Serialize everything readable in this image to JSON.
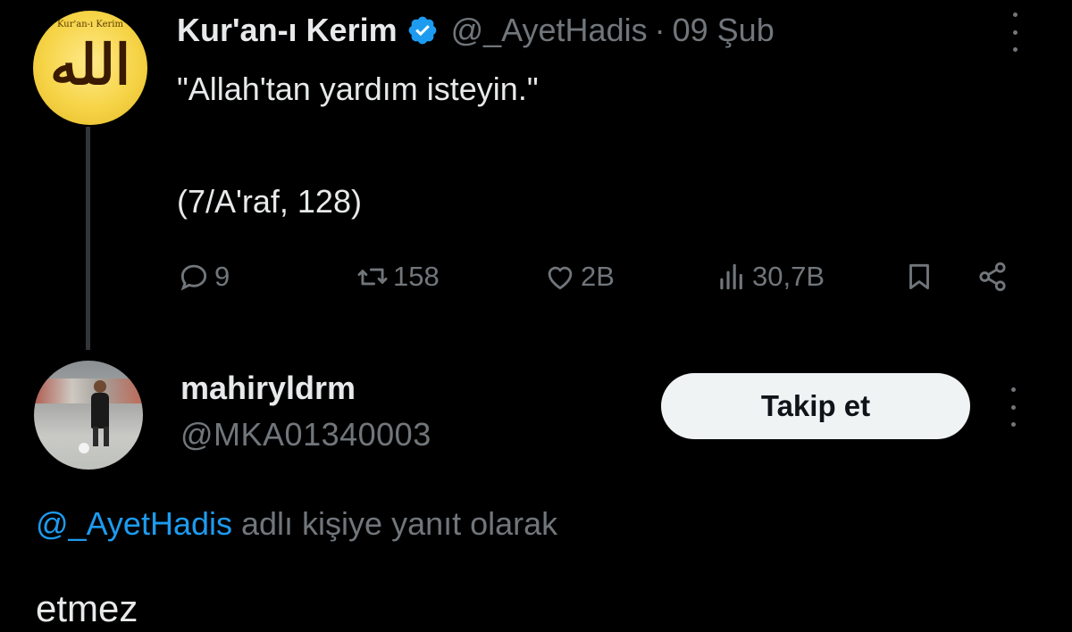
{
  "tweet": {
    "display_name": "Kur'an-ı Kerim",
    "handle": "@_AyetHadis",
    "separator": "·",
    "date": "09 Şub",
    "text": "\"Allah'tan yardım isteyin.\"",
    "reference": "(7/A'raf, 128)",
    "avatar_top_text": "Kur'an-ı Kerim",
    "avatar_glyph": "الله",
    "stats": {
      "replies": "9",
      "retweets": "158",
      "likes": "2B",
      "views": "30,7B"
    }
  },
  "reply_user": {
    "display_name": "mahiryldrm",
    "handle": "@MKA01340003",
    "follow_label": "Takip et"
  },
  "reply": {
    "mention": "@_AyetHadis",
    "context_suffix": " adlı kişiye yanıt olarak",
    "text": "etmez"
  },
  "colors": {
    "background": "#000000",
    "text_primary": "#e7e9ea",
    "text_secondary": "#71767b",
    "accent": "#1d9bf0",
    "follow_button_bg": "#eff3f4"
  },
  "icons": [
    "verified-badge-icon",
    "more-options-icon",
    "reply-icon",
    "retweet-icon",
    "like-icon",
    "views-icon",
    "bookmark-icon",
    "share-icon"
  ]
}
